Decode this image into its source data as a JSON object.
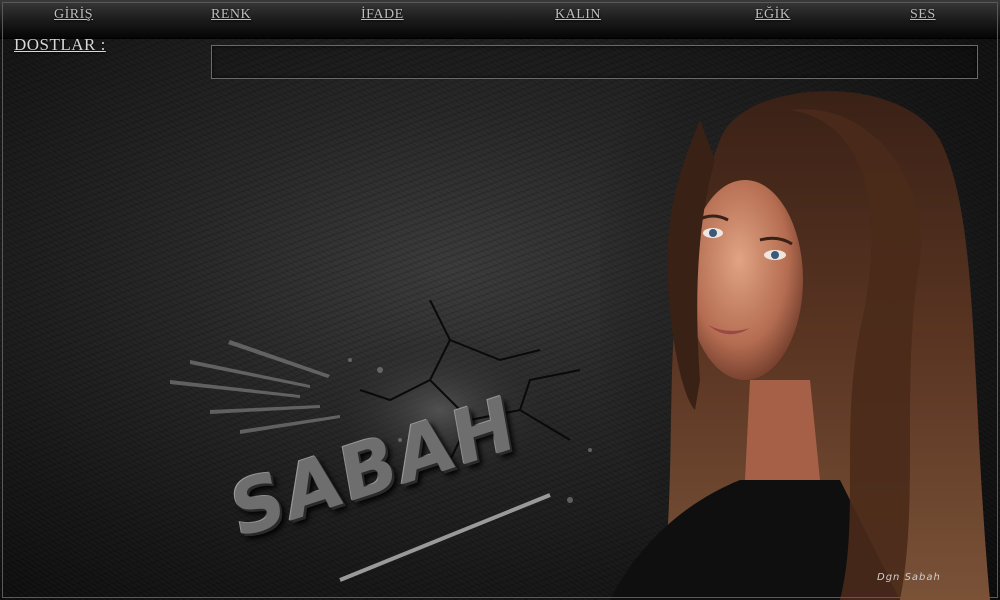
{
  "nav": {
    "items": [
      {
        "label": "GİRİŞ"
      },
      {
        "label": "RENK"
      },
      {
        "label": "İFADE"
      },
      {
        "label": "KALIN"
      },
      {
        "label": "EĞİK"
      },
      {
        "label": "SES"
      }
    ]
  },
  "friends": {
    "label": "DOSTLAR :",
    "value": ""
  },
  "artwork": {
    "logo_text": "SABAH",
    "signature": "Dgn Sabah"
  },
  "colors": {
    "background": "#1e1e1e",
    "text": "#bdbdbd",
    "hair": "#4a2a1a",
    "skin": "#c9876a"
  }
}
